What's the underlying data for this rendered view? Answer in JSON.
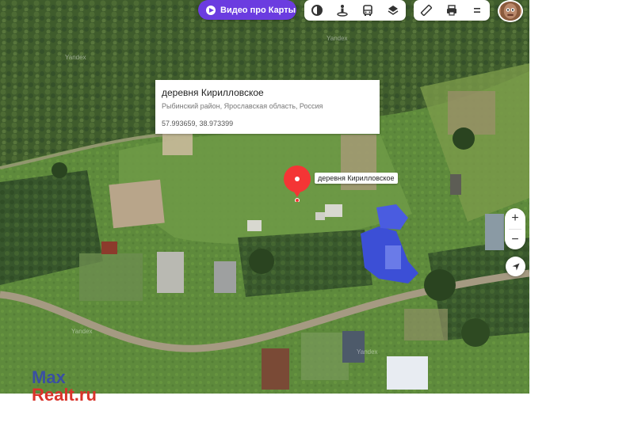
{
  "map": {
    "watermark": "Yandex"
  },
  "toolbar": {
    "video_label": "Видео про Карты",
    "layers_icon": "layers-icon",
    "panorama_icon": "panorama-person-icon",
    "transport_icon": "bus-icon",
    "layer_stack_icon": "map-layers-stack-icon",
    "ruler_icon": "ruler-icon",
    "print_icon": "printer-icon",
    "menu_icon": "hamburger-menu-icon"
  },
  "place_card": {
    "title": "деревня Кирилловское",
    "address": "Рыбинский район, Ярославская область, Россия",
    "coordinates": "57.993659, 38.973399"
  },
  "marker": {
    "label": "деревня Кирилловское",
    "color": "#f43535"
  },
  "zoom": {
    "in_label": "+",
    "out_label": "−"
  },
  "site_logo": {
    "line1": "Max",
    "line2": "Realt.ru",
    "color1": "#3a4fa2",
    "color2": "#d9342b"
  },
  "colors": {
    "video_button": "#6b3ce0",
    "roof_blue": "#3c4fd6"
  }
}
